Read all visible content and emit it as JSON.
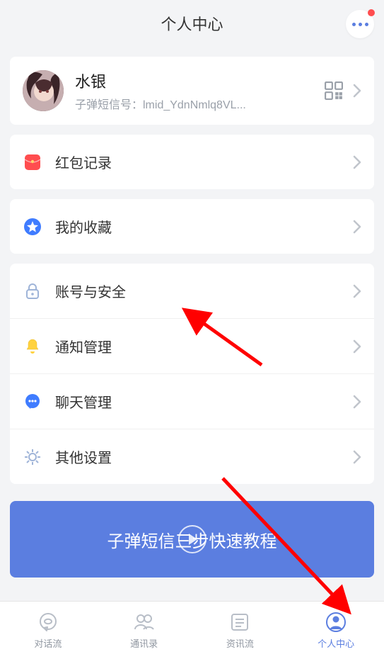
{
  "header": {
    "title": "个人中心"
  },
  "profile": {
    "name": "水银",
    "id_line": "子弹短信号：lmid_YdnNmlq8VL..."
  },
  "rows": {
    "redpacket": "红包记录",
    "favorites": "我的收藏",
    "security": "账号与安全",
    "notifications": "通知管理",
    "chat": "聊天管理",
    "other": "其他设置"
  },
  "tutorial": {
    "text": "子弹短信三步快速教程"
  },
  "tabs": {
    "chatflow": "对话流",
    "contacts": "通讯录",
    "newsfeed": "资讯流",
    "profile": "个人中心"
  }
}
